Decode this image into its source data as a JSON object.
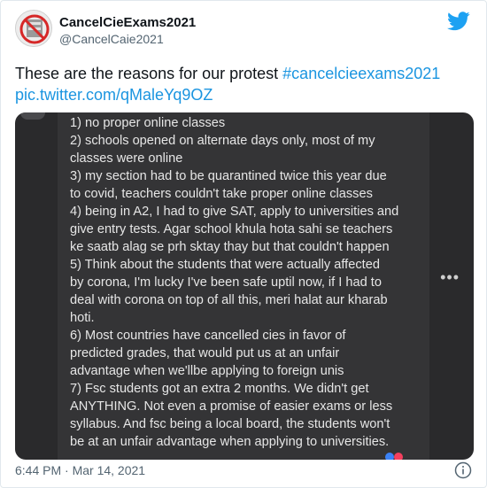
{
  "tweet": {
    "display_name": "CancelCieExams2021",
    "handle": "@CancelCaie2021",
    "text_plain": "These are the reasons for our protest ",
    "hashtag": "#cancelcieexams2021",
    "link": "pic.twitter.com/qMaleYq9OZ",
    "timestamp": "6:44 PM · Mar 14, 2021"
  },
  "media": {
    "lines": [
      "1) no proper online classes",
      "2) schools opened on alternate days only, most of my",
      "classes were online",
      "3) my section had to be quarantined twice this year due",
      "to covid, teachers couldn't take proper online classes",
      "4) being in A2, I had to give SAT, apply to universities and",
      "give entry tests. Agar school khula hota sahi se teachers",
      "ke saatb alag se prh sktay thay but that couldn't happen",
      "5) Think about the students that were actually affected",
      "by corona, I'm lucky I've been safe uptil now, if I had to",
      "deal with corona on top of all this, meri halat aur kharab",
      "hoti.",
      "6) Most countries have cancelled cies in favor of",
      "predicted grades, that would put us at an unfair",
      "advantage when we'llbe applying to foreign unis",
      "7) Fsc students got an extra 2 months. We didn't get",
      "ANYTHING. Not even a promise of easier exams or less",
      "syllabus. And fsc being a local board, the students won't",
      "be at an unfair advantage when applying to universities."
    ],
    "more_label": "•••"
  },
  "icons": {
    "avatar": "cancel-exams-logo",
    "bird": "twitter-bird-icon",
    "info": "info-icon",
    "more": "more-options-icon"
  },
  "colors": {
    "link": "#1b95e0",
    "twitter_blue": "#1da1f2",
    "media_bg": "#2a2a2c"
  }
}
